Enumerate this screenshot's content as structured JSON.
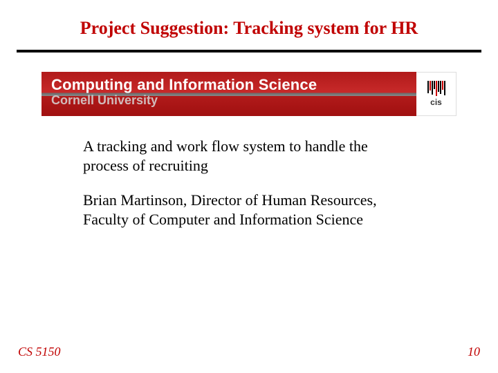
{
  "title": "Project Suggestion: Tracking system for HR",
  "banner": {
    "main": "Computing and Information Science",
    "sub": "Cornell University",
    "logo_label": "cis"
  },
  "paragraphs": {
    "p1": "A tracking and work flow system to handle the process of recruiting",
    "p2": "Brian Martinson, Director of Human Resources, Faculty of Computer and Information Science"
  },
  "footer": {
    "course": "CS 5150",
    "page": "10"
  }
}
